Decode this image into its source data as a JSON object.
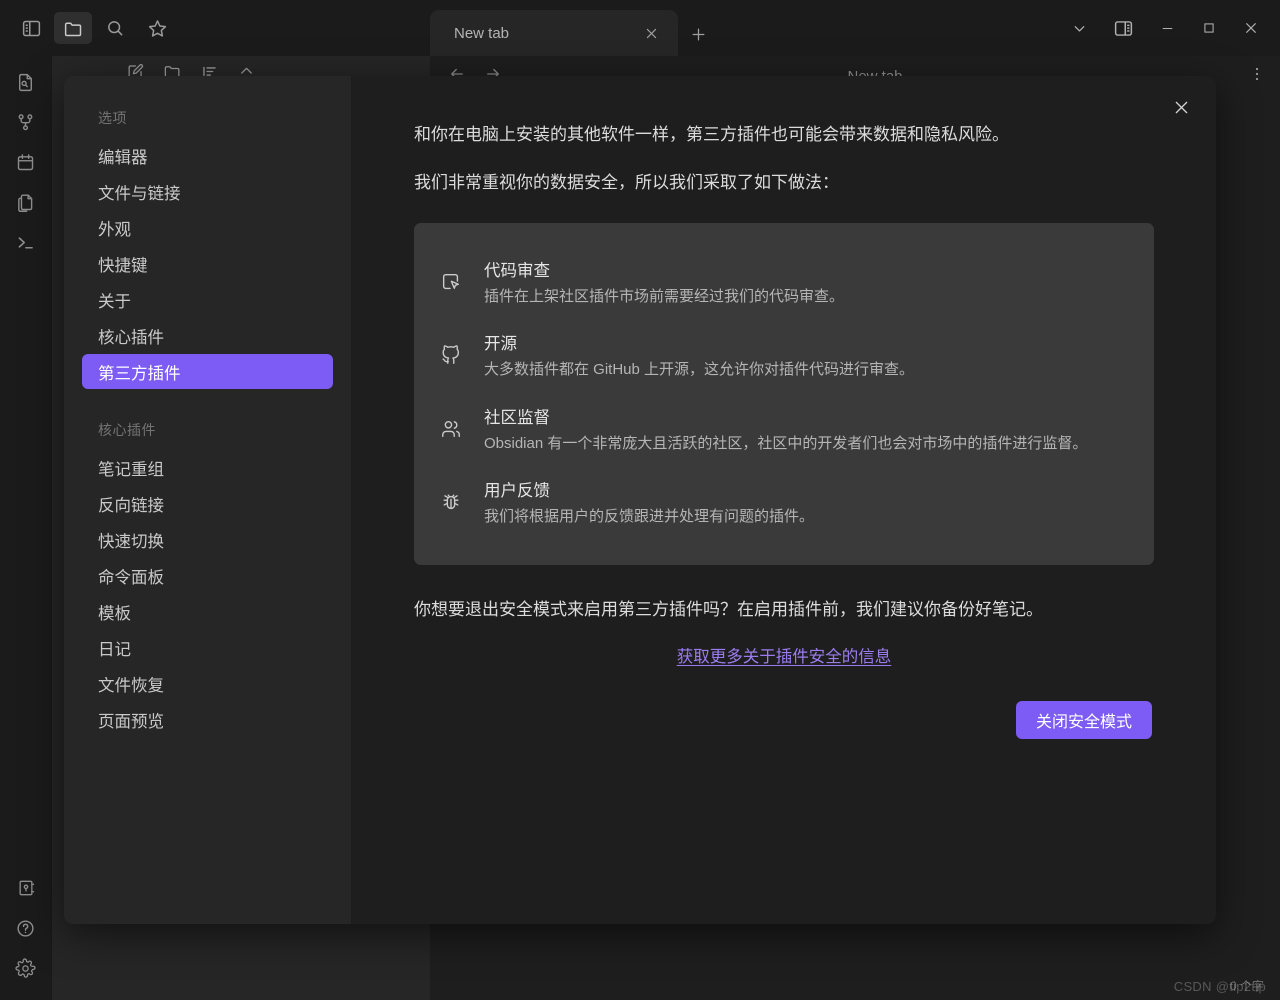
{
  "window": {
    "toolbar_icons": [
      {
        "name": "sidebar-toggle-icon",
        "label": "切换侧边栏"
      },
      {
        "name": "folder-icon",
        "label": "文件"
      },
      {
        "name": "search-icon",
        "label": "搜索"
      },
      {
        "name": "star-icon",
        "label": "收藏"
      }
    ],
    "tab": {
      "title": "New tab",
      "close_label": "×",
      "new_tab_label": "+"
    },
    "controls": [
      {
        "name": "chevron-down-icon",
        "label": "⌄"
      },
      {
        "name": "right-sidebar-toggle-icon",
        "label": "切换右侧边栏"
      },
      {
        "name": "minimize-button",
        "label": "—"
      },
      {
        "name": "maximize-button",
        "label": "□"
      },
      {
        "name": "close-button",
        "label": "✕"
      }
    ]
  },
  "ribbon": {
    "top_icons": [
      {
        "name": "file-search-icon"
      },
      {
        "name": "graph-view-icon"
      },
      {
        "name": "calendar-icon"
      },
      {
        "name": "copy-files-icon"
      },
      {
        "name": "terminal-icon"
      }
    ],
    "bottom_icons": [
      {
        "name": "vault-icon"
      },
      {
        "name": "help-icon"
      },
      {
        "name": "settings-gear-icon"
      }
    ]
  },
  "explorer": {
    "toolbar_icons": [
      {
        "name": "new-note-icon"
      },
      {
        "name": "new-folder-icon"
      },
      {
        "name": "sort-icon"
      },
      {
        "name": "collapse-all-icon"
      }
    ]
  },
  "main_pane": {
    "header_title": "New tab",
    "back_icon": "back-arrow-icon",
    "forward_icon": "forward-arrow-icon",
    "more_icon": "more-options-icon",
    "status_text": "0 个字",
    "watermark": "CSDN @tip2tip"
  },
  "modal": {
    "close_label": "✕",
    "sidebar": {
      "groups": [
        {
          "title": "选项",
          "items": [
            {
              "label": "编辑器",
              "selected": false
            },
            {
              "label": "文件与链接",
              "selected": false
            },
            {
              "label": "外观",
              "selected": false
            },
            {
              "label": "快捷键",
              "selected": false
            },
            {
              "label": "关于",
              "selected": false
            },
            {
              "label": "核心插件",
              "selected": false
            },
            {
              "label": "第三方插件",
              "selected": true
            }
          ]
        },
        {
          "title": "核心插件",
          "items": [
            {
              "label": "笔记重组",
              "selected": false
            },
            {
              "label": "反向链接",
              "selected": false
            },
            {
              "label": "快速切换",
              "selected": false
            },
            {
              "label": "命令面板",
              "selected": false
            },
            {
              "label": "模板",
              "selected": false
            },
            {
              "label": "日记",
              "selected": false
            },
            {
              "label": "文件恢复",
              "selected": false
            },
            {
              "label": "页面预览",
              "selected": false
            }
          ]
        }
      ]
    },
    "content": {
      "paragraph_1": "和你在电脑上安装的其他软件一样，第三方插件也可能会带来数据和隐私风险。",
      "paragraph_2": "我们非常重视你的数据安全，所以我们采取了如下做法：",
      "features": [
        {
          "icon": "mouse-pointer-square-icon",
          "title": "代码审查",
          "desc": "插件在上架社区插件市场前需要经过我们的代码审查。"
        },
        {
          "icon": "github-icon",
          "title": "开源",
          "desc": "大多数插件都在 GitHub 上开源，这允许你对插件代码进行审查。"
        },
        {
          "icon": "users-icon",
          "title": "社区监督",
          "desc": "Obsidian 有一个非常庞大且活跃的社区，社区中的开发者们也会对市场中的插件进行监督。"
        },
        {
          "icon": "bug-icon",
          "title": "用户反馈",
          "desc": "我们将根据用户的反馈跟进并处理有问题的插件。"
        }
      ],
      "prompt": "你想要退出安全模式来启用第三方插件吗？在启用插件前，我们建议你备份好笔记。",
      "more_info_link": "获取更多关于插件安全的信息",
      "primary_button": "关闭安全模式"
    }
  },
  "colors": {
    "accent": "#7c5cf5",
    "link": "#9b7cf0",
    "card_bg": "#3a3a3a",
    "modal_bg": "#1e1e1e",
    "sidebar_bg": "#262626"
  }
}
